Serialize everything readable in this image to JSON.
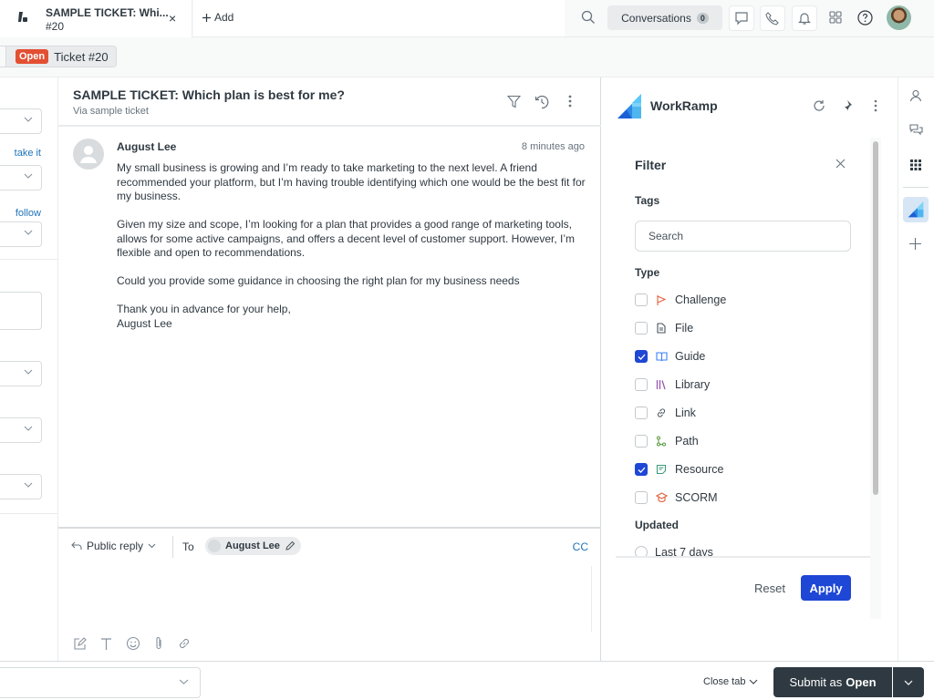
{
  "topbar": {
    "tab": {
      "title": "SAMPLE TICKET: Whi...",
      "subtitle": "#20",
      "close": "×"
    },
    "add_label": "Add",
    "conversations": {
      "label": "Conversations",
      "count": "0"
    }
  },
  "subbar": {
    "status": "Open",
    "ticket_label": "Ticket #20"
  },
  "leftpanel": {
    "take_it": "take it",
    "follow": "follow"
  },
  "conversation": {
    "title": "SAMPLE TICKET: Which plan is best for me?",
    "via": "Via sample ticket",
    "message": {
      "author": "August Lee",
      "time": "8 minutes ago",
      "paragraphs": [
        "My small business is growing and I’m ready to take marketing to the next level. A friend recommended your platform, but I’m having trouble identifying which one would be the best fit for my business.",
        "Given my size and scope, I’m looking for a plan that provides a good range of marketing tools, allows for some active campaigns, and offers a decent level of customer support. However, I’m flexible and open to recommendations.",
        "Could you provide some guidance in choosing the right plan for my business needs",
        "Thank you in advance for your help,\nAugust Lee"
      ]
    }
  },
  "composer": {
    "reply_type": "Public reply",
    "to_label": "To",
    "recipient": "August Lee",
    "cc": "CC"
  },
  "app": {
    "name": "WorkRamp",
    "filter": {
      "title": "Filter",
      "tags_label": "Tags",
      "search_placeholder": "Search",
      "type_label": "Type",
      "types": [
        {
          "label": "Challenge",
          "checked": false,
          "icon": "flag-icon",
          "color": "#e0613f"
        },
        {
          "label": "File",
          "checked": false,
          "icon": "file-icon",
          "color": "#49545c"
        },
        {
          "label": "Guide",
          "checked": true,
          "icon": "book-icon",
          "color": "#3b82f6"
        },
        {
          "label": "Library",
          "checked": false,
          "icon": "library-icon",
          "color": "#9b59b6"
        },
        {
          "label": "Link",
          "checked": false,
          "icon": "link-icon",
          "color": "#49545c"
        },
        {
          "label": "Path",
          "checked": false,
          "icon": "path-icon",
          "color": "#5a9a3e"
        },
        {
          "label": "Resource",
          "checked": true,
          "icon": "resource-icon",
          "color": "#3e9a7a"
        },
        {
          "label": "SCORM",
          "checked": false,
          "icon": "scorm-icon",
          "color": "#e0613f"
        }
      ],
      "updated_label": "Updated",
      "updated_option": "Last 7 days",
      "reset": "Reset",
      "apply": "Apply"
    }
  },
  "bottombar": {
    "close_tab": "Close tab",
    "submit_prefix": "Submit as",
    "submit_status": "Open"
  },
  "colors": {
    "open_badge": "#e34f32",
    "primary_blue": "#1f47d6",
    "link_blue": "#1f73b7",
    "submit_dark": "#2f3941"
  }
}
